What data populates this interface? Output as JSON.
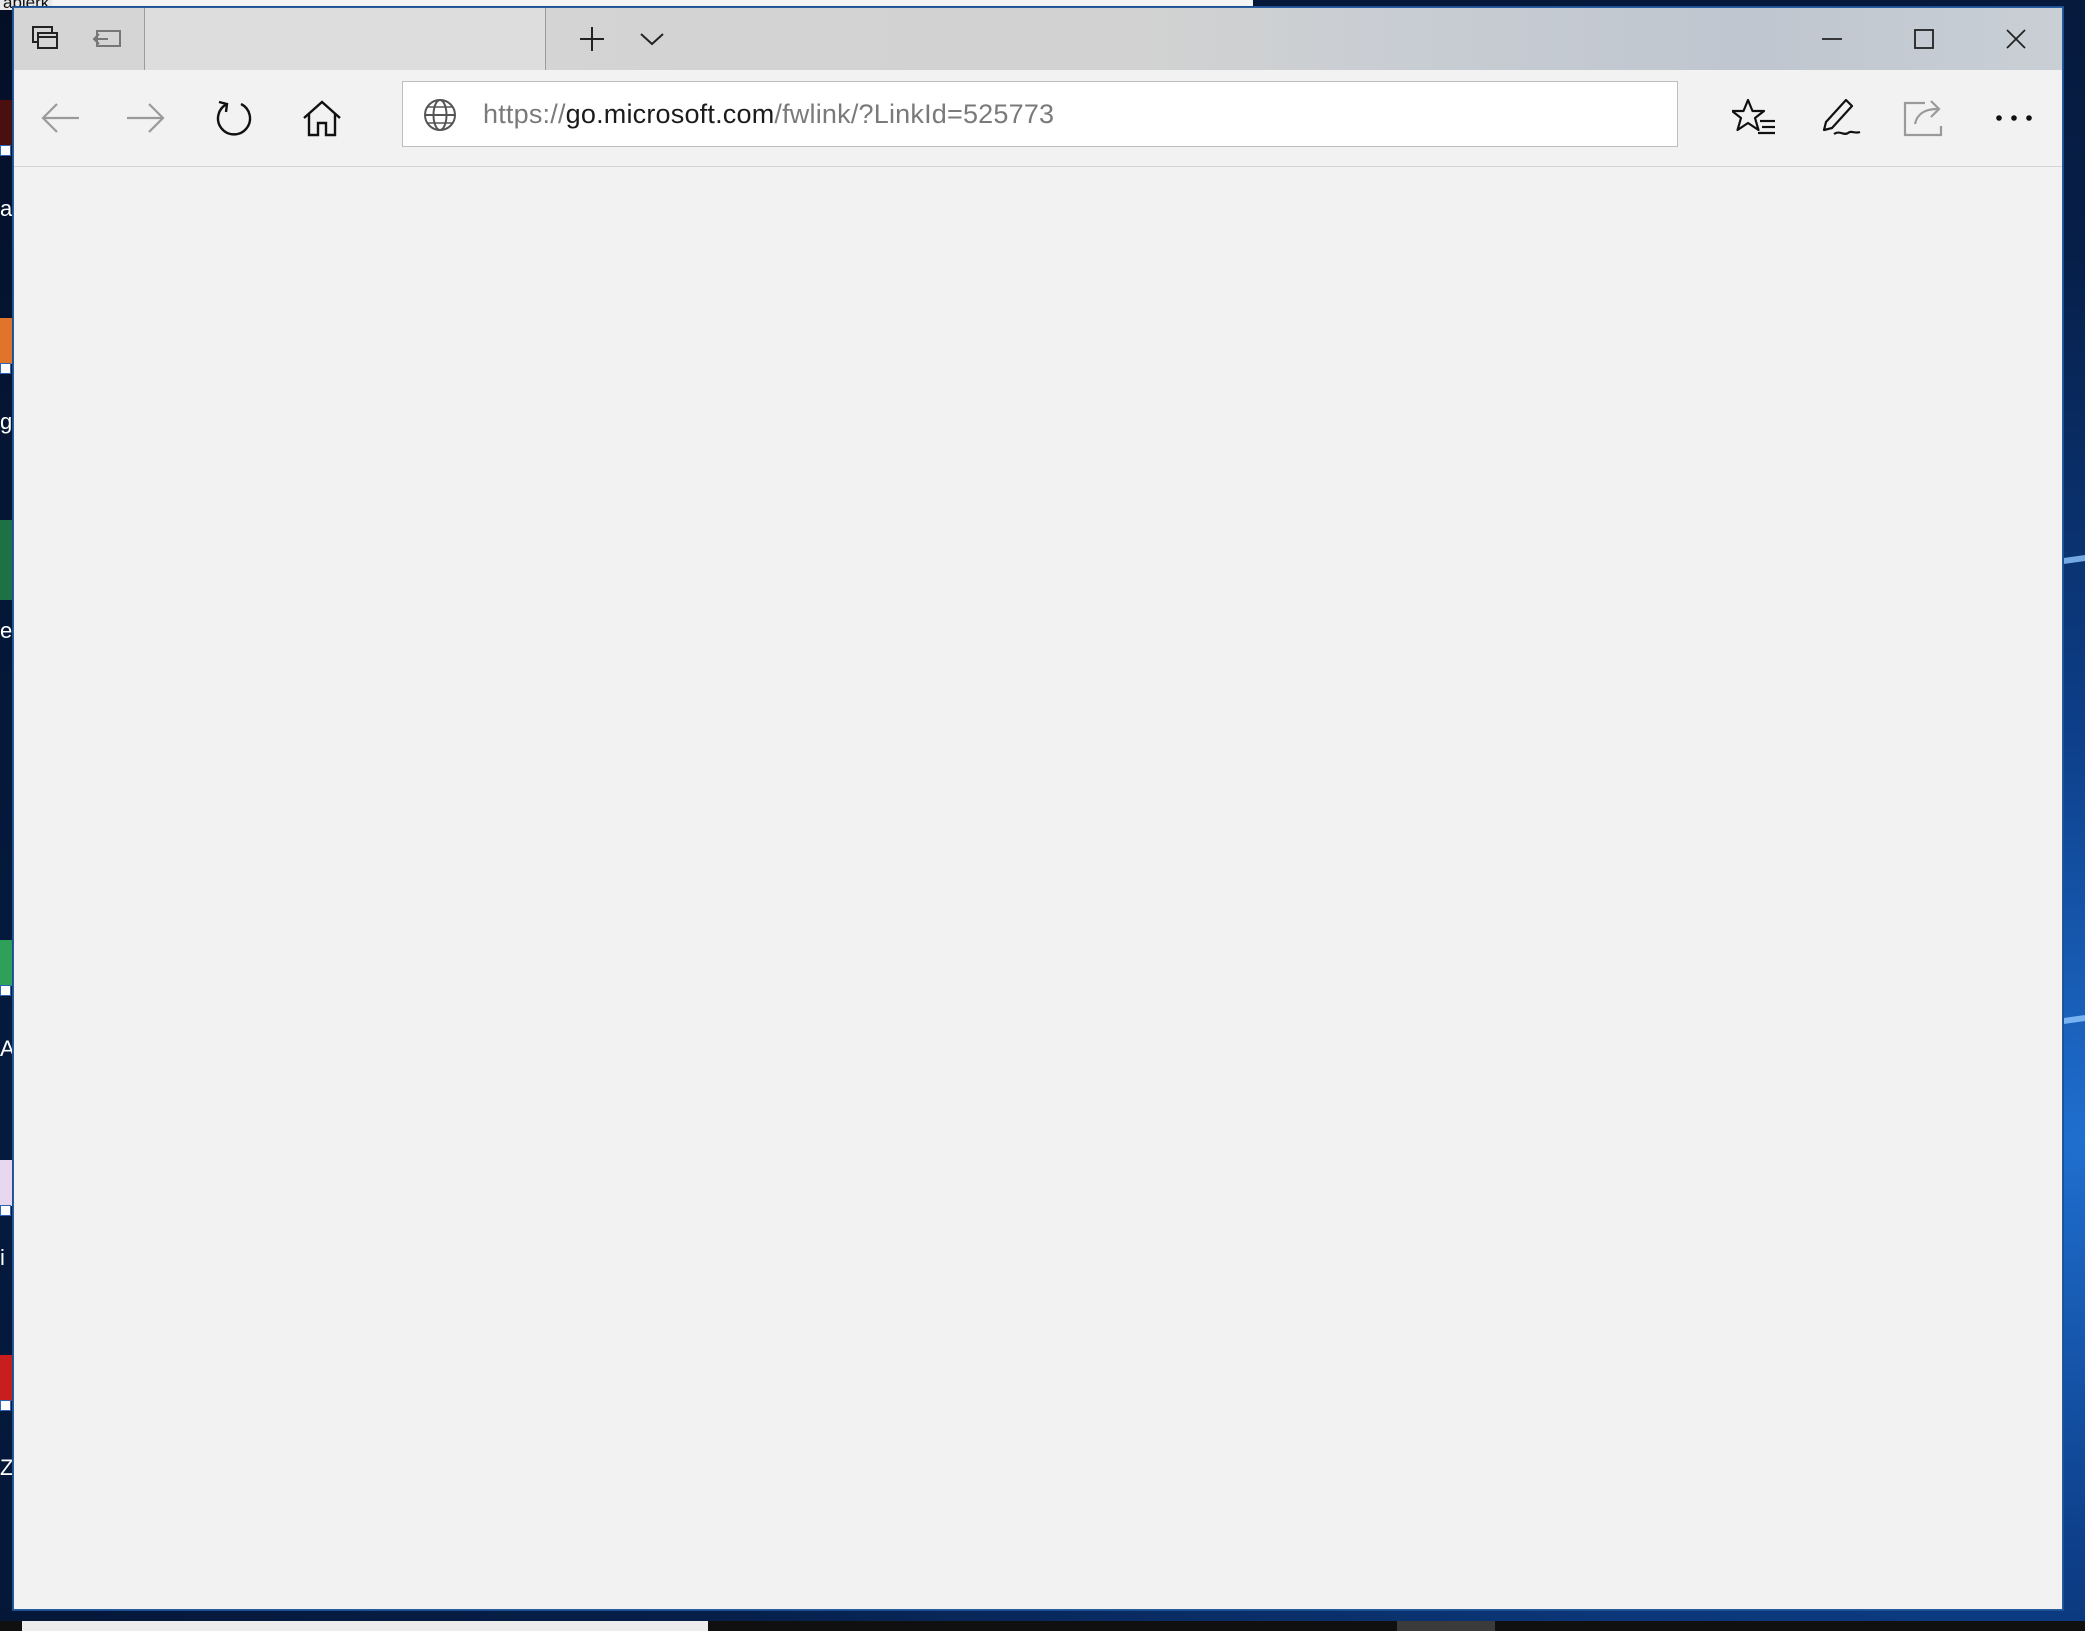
{
  "desktop": {
    "behind_window_title": "apierk",
    "icon_labels": [
      "a",
      "g",
      "e",
      "A",
      "i",
      "Z"
    ]
  },
  "browser": {
    "tab_tools": {
      "set_aside_tooltip": "",
      "tab_preview_tooltip": ""
    },
    "new_tab_icon": "plus-icon",
    "tab_list_icon": "chevron-down-icon",
    "caption": [
      "minimize-icon",
      "maximize-icon",
      "close-icon"
    ],
    "nav": [
      "back-arrow-icon",
      "forward-arrow-icon",
      "refresh-icon",
      "home-icon"
    ],
    "address_bar": {
      "scheme": "https://",
      "host": "go.microsoft.com",
      "path": "/fwlink/?LinkId=525773"
    },
    "toolbar": [
      "favorites-star-icon",
      "web-note-pen-icon",
      "share-icon",
      "more-dots-icon"
    ]
  },
  "colors": {
    "window_border": "#2a5d9e",
    "page_background": "#f2f2f2",
    "url_dim": "#7a7a7a",
    "url_host": "#1b1b1b"
  }
}
